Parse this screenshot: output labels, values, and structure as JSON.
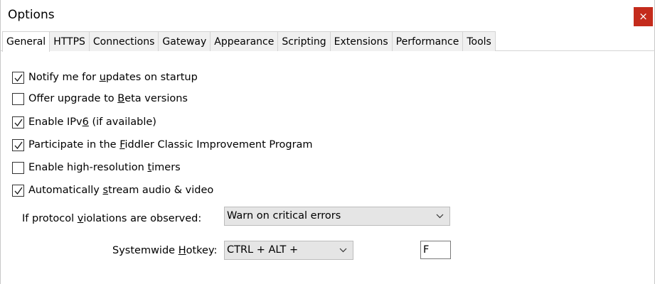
{
  "window": {
    "title": "Options",
    "close_label": "×"
  },
  "tabs": [
    {
      "label": "General",
      "active": true
    },
    {
      "label": "HTTPS"
    },
    {
      "label": "Connections"
    },
    {
      "label": "Gateway"
    },
    {
      "label": "Appearance"
    },
    {
      "label": "Scripting"
    },
    {
      "label": "Extensions"
    },
    {
      "label": "Performance"
    },
    {
      "label": "Tools"
    }
  ],
  "options": [
    {
      "pre": "Notify me for ",
      "acc": "u",
      "post": "pdates on startup",
      "checked": true
    },
    {
      "pre": "Offer upgrade to ",
      "acc": "B",
      "post": "eta versions",
      "checked": false
    },
    {
      "pre": "Enable IPv",
      "acc": "6",
      "post": " (if available)",
      "checked": true
    },
    {
      "pre": "Participate in the ",
      "acc": "F",
      "post": "iddler Classic Improvement Program",
      "checked": true
    },
    {
      "pre": "Enable high-resolution ",
      "acc": "t",
      "post": "imers",
      "checked": false
    },
    {
      "pre": "Automatically ",
      "acc": "s",
      "post": "tream audio & video",
      "checked": true
    }
  ],
  "protocol": {
    "label_pre": "If protocol ",
    "label_acc": "v",
    "label_post": "iolations are observed:",
    "value": "Warn on critical errors"
  },
  "hotkey": {
    "label_pre": "Systemwide ",
    "label_acc": "H",
    "label_post": "otkey:",
    "modifier_value": "CTRL + ALT +",
    "key_value": "F"
  }
}
